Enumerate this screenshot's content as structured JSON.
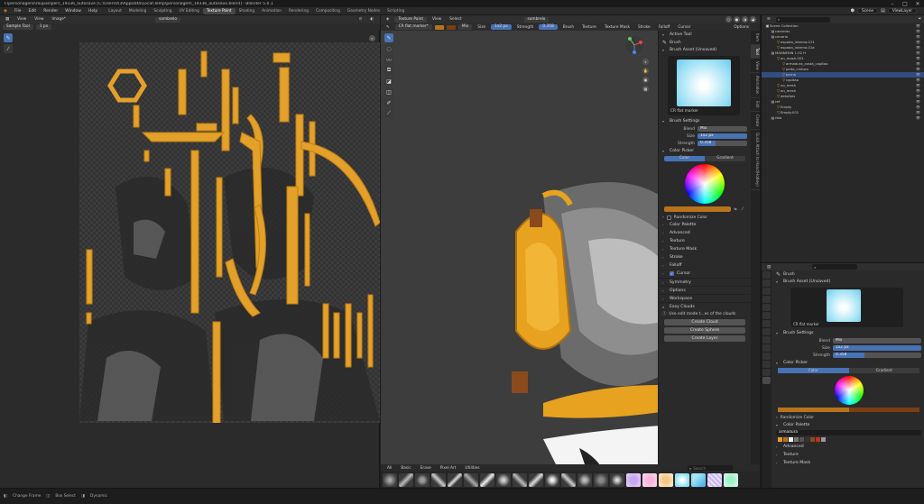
{
  "window": {
    "title": "T:\\personagens\\roupas\\pers_19336_autosave [C:\\Users\\h3\\AppData\\Local\\Temp\\personagem_19336_autosave.blend] - Blender 5.0.1",
    "controls": [
      "–",
      "□",
      "✕"
    ]
  },
  "menu": [
    "File",
    "Edit",
    "Render",
    "Window",
    "Help"
  ],
  "workspaces": [
    "Layout",
    "Modeling",
    "Sculpting",
    "UV Editing",
    "Texture Paint",
    "Shading",
    "Animation",
    "Rendering",
    "Compositing",
    "Geometry Nodes",
    "Scripting"
  ],
  "active_workspace": "Texture Paint",
  "scene": {
    "name": "Scene",
    "view_layer": "ViewLayer"
  },
  "image_editor": {
    "header_items": [
      "View",
      "View",
      "Image*"
    ],
    "image_name": "sombrelo",
    "sample_tool": "Sample Tool",
    "sample_value": "1 px"
  },
  "viewport": {
    "mode": "Texture Paint",
    "header_items": [
      "View",
      "Select"
    ],
    "uv_map": "sombrelo",
    "brush_name": "CR flat marker*",
    "blend": "Mix",
    "radius_label": "Size",
    "radius_value": "1x2 px",
    "strength_label": "Strength",
    "strength_value": "0.358",
    "tool_items": [
      "Brush",
      "Texture",
      "Texture Mask",
      "Stroke",
      "Falloff",
      "Cursor"
    ],
    "options": "Options"
  },
  "npanel": {
    "active_tool": "Active Tool",
    "brush_label": "Brush",
    "brush_asset": "Brush Asset (Unsaved)",
    "brush_asset_name": "CR flat marker",
    "brush_settings": "Brush Settings",
    "blend_label": "Blend",
    "blend_value": "Mix",
    "size_label": "Size",
    "size_value": "1x2 px",
    "strength_label": "Strength",
    "strength_value": "0.358",
    "strength_fraction": 0.358,
    "color_picker": "Color Picker",
    "color_tab": "Color",
    "gradient_tab": "Gradient",
    "active_color": "#b8731c",
    "randomize_color": "Randomize Color",
    "sections": [
      "Color Palette",
      "Advanced",
      "Texture",
      "Texture Mask",
      "Stroke",
      "Falloff",
      "Cursor"
    ],
    "symmetry": "Symmetry",
    "options": "Options",
    "workspace": "Workspace",
    "easy_clouds": "Easy Clouds",
    "easy_clouds_hint": "Use edit mode t...es of the clouds",
    "buttons": [
      "Create Cloud",
      "Create Sphere",
      "Create Layer"
    ],
    "tabs": [
      "Item",
      "Tool",
      "View",
      "Animation",
      "Edit",
      "Create",
      "Quick Attach to Hand(Hotkey)"
    ]
  },
  "asset_shelf": {
    "tabs": [
      "All",
      "Basic",
      "Erase",
      "Pixel Art",
      "Utilities"
    ],
    "search_placeholder": "Search"
  },
  "outliner": {
    "search_placeholder": "",
    "rows": [
      {
        "indent": 0,
        "name": "Scene Collection",
        "sel": false
      },
      {
        "indent": 1,
        "name": "cameras",
        "sel": false
      },
      {
        "indent": 1,
        "name": "cenario",
        "sel": false
      },
      {
        "indent": 2,
        "name": "espada_interna.011",
        "sel": false
      },
      {
        "indent": 2,
        "name": "espada_interna.01a",
        "sel": false
      },
      {
        "indent": 1,
        "name": "MANNEKIN 1.02 H",
        "sel": false
      },
      {
        "indent": 2,
        "name": "on_mash.001",
        "sel": false
      },
      {
        "indent": 3,
        "name": "armadura_costa_capitao",
        "sel": false
      },
      {
        "indent": 3,
        "name": "peito_cintura",
        "sel": false
      },
      {
        "indent": 3,
        "name": "perna",
        "sel": true
      },
      {
        "indent": 3,
        "name": "capitao",
        "sel": false
      },
      {
        "indent": 2,
        "name": "no_mesh",
        "sel": false
      },
      {
        "indent": 2,
        "name": "on_mesh",
        "sel": false
      },
      {
        "indent": 2,
        "name": "detalhes",
        "sel": false
      },
      {
        "indent": 1,
        "name": "ref",
        "sel": false
      },
      {
        "indent": 2,
        "name": "Empty",
        "sel": false
      },
      {
        "indent": 2,
        "name": "Empty.001",
        "sel": false
      },
      {
        "indent": 1,
        "name": "rbla",
        "sel": false
      }
    ]
  },
  "properties": {
    "brush_label": "Brush",
    "brush_asset": "Brush Asset (Unsaved)",
    "brush_asset_name": "CR flat marker",
    "brush_settings": "Brush Settings",
    "blend_label": "Blend",
    "blend_value": "Mix",
    "size_label": "Size",
    "size_value": "1x2 px",
    "strength_label": "Strength",
    "strength_value": "0.358",
    "color_picker": "Color Picker",
    "color_tab": "Color",
    "gradient_tab": "Gradient",
    "randomize_color": "Randomize Color",
    "color_palette": "Color Palette",
    "palette_name": "armadura",
    "sections": [
      "Advanced",
      "Texture",
      "Texture Mask"
    ]
  },
  "status": [
    "Change Frame",
    "Box Select",
    "Dynamic"
  ]
}
